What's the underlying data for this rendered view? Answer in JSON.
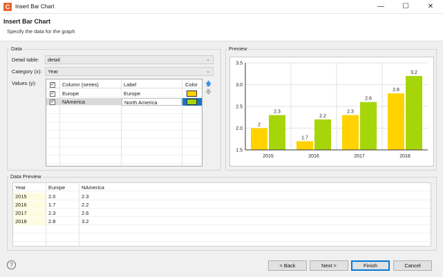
{
  "window": {
    "title": "Insert Bar Chart",
    "app_icon_letter": "C"
  },
  "banner": {
    "title": "Insert Bar Chart",
    "subtitle": "Specify the data for the graph"
  },
  "data_group": {
    "label": "Data",
    "detail_table_label": "Detail table:",
    "detail_table_value": "detail",
    "category_label": "Category (x):",
    "category_value": "Year",
    "values_label": "Values (y):",
    "columns": {
      "series": "Column (series)",
      "label": "Label",
      "color": "Color"
    },
    "rows": [
      {
        "checked": true,
        "series": "Europe",
        "label": "Europe",
        "color": "#ffd200"
      },
      {
        "checked": true,
        "series": "NAmerica",
        "label": "North America",
        "color": "#a6d60a"
      }
    ]
  },
  "preview_group": {
    "label": "Preview"
  },
  "chart_data": {
    "type": "bar",
    "categories": [
      "2015",
      "2016",
      "2017",
      "2018"
    ],
    "series": [
      {
        "values": [
          2,
          1.7,
          2.3,
          2.8
        ],
        "color": "#ffd200"
      },
      {
        "values": [
          2.3,
          2.2,
          2.6,
          3.2
        ],
        "color": "#a6d60a"
      }
    ],
    "value_labels": [
      [
        "2",
        "1.7",
        "2.3",
        "2.8"
      ],
      [
        "2.3",
        "2.2",
        "2.6",
        "3.2"
      ]
    ],
    "ylim": [
      1.5,
      3.5
    ],
    "yticks": [
      "1.5",
      "2.0",
      "2.5",
      "3.0",
      "3.5"
    ],
    "grid": true
  },
  "data_preview": {
    "label": "Data Preview",
    "headers": [
      "Year",
      "Europe",
      "NAmerica"
    ],
    "rows": [
      [
        "2015",
        "2.0",
        "2.3"
      ],
      [
        "2016",
        "1.7",
        "2.2"
      ],
      [
        "2017",
        "2.3",
        "2.6"
      ],
      [
        "2018",
        "2.8",
        "3.2"
      ]
    ]
  },
  "buttons": {
    "back": "< Back",
    "next": "Next >",
    "finish": "Finish",
    "cancel": "Cancel",
    "help": "?"
  },
  "colors": {
    "accent": "#0078d7",
    "europe": "#ffd200",
    "namerica": "#a6d60a",
    "highlight": "#fffbe0"
  }
}
